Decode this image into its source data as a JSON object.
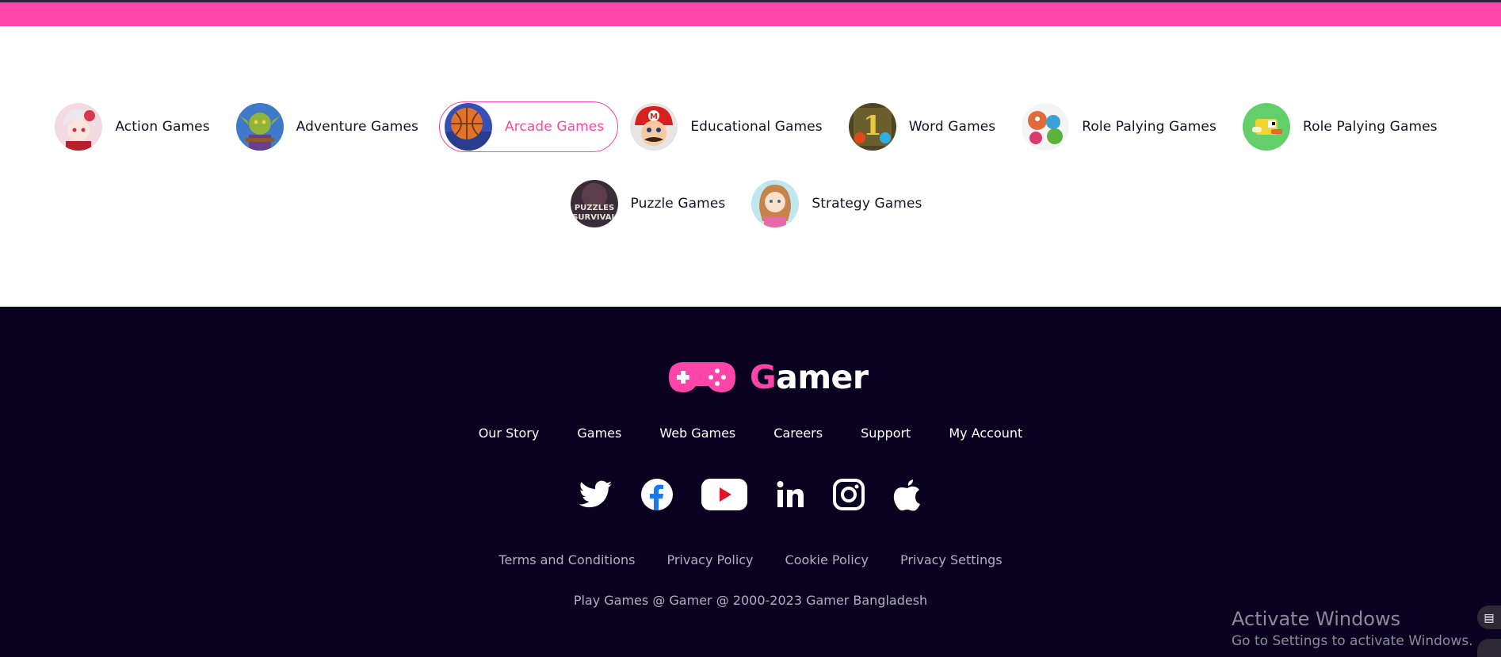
{
  "categories": [
    {
      "label": "Action Games",
      "icon": "anime-girl-thumbnail",
      "active": false
    },
    {
      "label": "Adventure Games",
      "icon": "goblin-thumbnail",
      "active": false
    },
    {
      "label": "Arcade Games",
      "icon": "basketball-thumbnail",
      "active": true
    },
    {
      "label": "Educational Games",
      "icon": "mario-thumbnail",
      "active": false
    },
    {
      "label": "Word Games",
      "icon": "fireboy-watergirl-thumbnail",
      "active": false
    },
    {
      "label": "Role Palying Games",
      "icon": "cartoon-characters-thumbnail",
      "active": false
    },
    {
      "label": "Role Palying Games",
      "icon": "flappy-bird-thumbnail",
      "active": false
    },
    {
      "label": "Puzzle Games",
      "icon": "puzzles-survival-thumbnail",
      "active": false
    },
    {
      "label": "Strategy Games",
      "icon": "cartoon-girl-thumbnail",
      "active": false
    }
  ],
  "footer": {
    "logo": {
      "first_letter": "G",
      "rest": "amer",
      "icon": "gamepad-icon"
    },
    "nav": [
      "Our Story",
      "Games",
      "Web Games",
      "Careers",
      "Support",
      "My Account"
    ],
    "socials": [
      "twitter-icon",
      "facebook-icon",
      "youtube-icon",
      "linkedin-icon",
      "instagram-icon",
      "apple-icon"
    ],
    "legal": [
      "Terms and Conditions",
      "Privacy Policy",
      "Cookie Policy",
      "Privacy Settings"
    ],
    "copyright": "Play Games @ Gamer @ 2000-2023 Gamer Bangladesh"
  },
  "watermark": {
    "title": "Activate Windows",
    "subtitle": "Go to Settings to activate Windows."
  },
  "colors": {
    "accent": "#ff45a9",
    "footer_bg": "#0a0220",
    "text_dark": "#15112a",
    "text_muted": "#b3aec4"
  }
}
